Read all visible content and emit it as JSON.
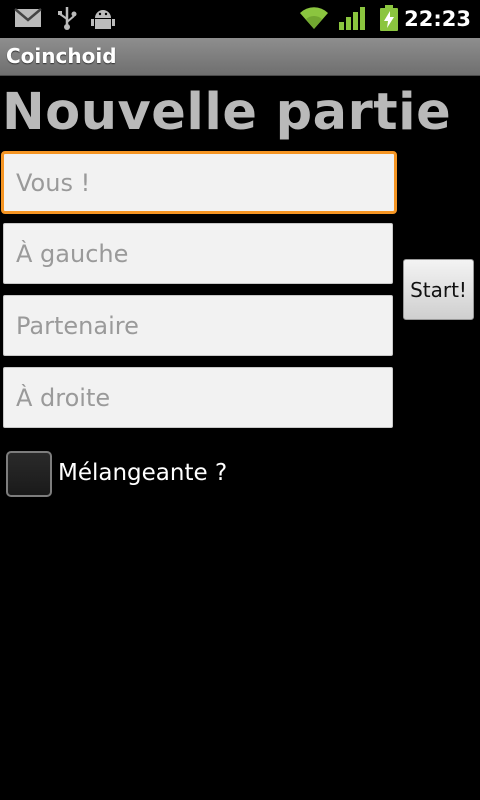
{
  "status_bar": {
    "time": "22:23",
    "icons": [
      "gmail-icon",
      "usb-icon",
      "android-debug-icon",
      "wifi-icon",
      "signal-icon",
      "battery-charging-icon"
    ]
  },
  "app": {
    "title": "Coinchoid"
  },
  "page": {
    "heading": "Nouvelle partie"
  },
  "form": {
    "player_you_placeholder": "Vous !",
    "player_left_placeholder": "À gauche",
    "partner_placeholder": "Partenaire",
    "player_right_placeholder": "À droite",
    "start_label": "Start!",
    "shuffle_label": "Mélangeante ?",
    "shuffle_checked": false
  },
  "colors": {
    "background": "#000000",
    "titlebar": "#7f7f7f",
    "heading": "#b9b9b9",
    "focus_border": "#f59523",
    "signal_green": "#8bc53f"
  }
}
